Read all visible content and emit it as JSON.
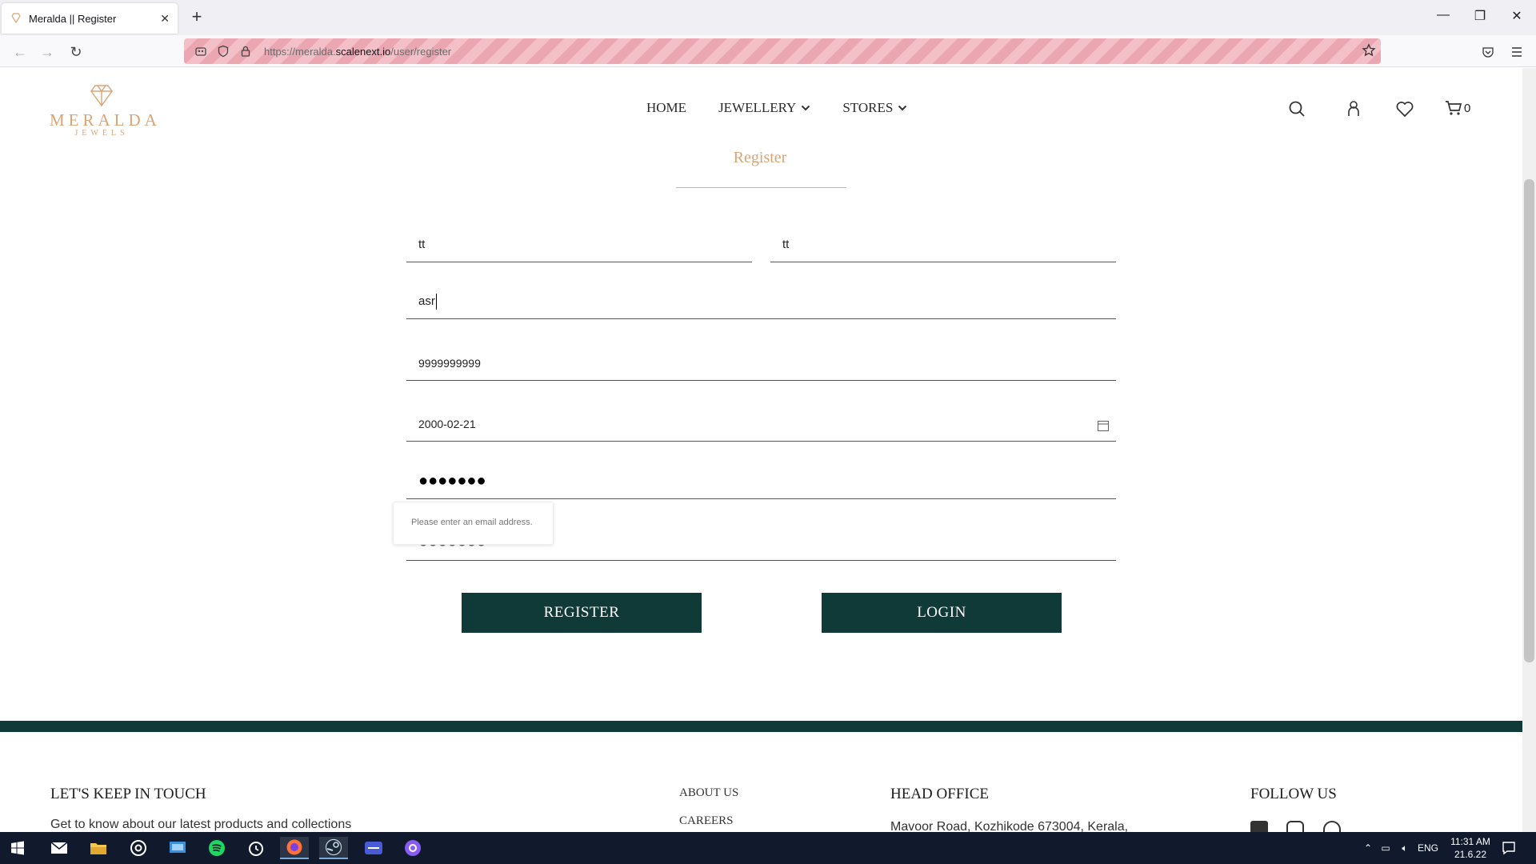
{
  "browser": {
    "tab_title": "Meralda || Register",
    "url_prefix": "https://meralda.",
    "url_domain": "scalenext.io",
    "url_path": "/user/register"
  },
  "site": {
    "logo_word": "MERALDA",
    "logo_sub": "JEWELS",
    "nav": {
      "home": "HOME",
      "jewellery": "JEWELLERY",
      "stores": "STORES"
    },
    "cart_count": "0"
  },
  "form": {
    "title": "Register",
    "first_name": "tt",
    "last_name": "tt",
    "email": "asr",
    "phone": "9999999999",
    "dob": "2000-02-21",
    "password_mask": "●●●●●●●",
    "confirm_mask": "●●●●●●●",
    "tooltip": "Please enter an email address.",
    "register_label": "REGISTER",
    "login_label": "LOGIN"
  },
  "footer": {
    "touch_heading": "LET'S KEEP IN TOUCH",
    "touch_text": "Get to know about our latest products and collections",
    "about": "ABOUT US",
    "careers": "CAREERS",
    "office_heading": "HEAD OFFICE",
    "office_address": "Mavoor Road, Kozhikode 673004, Kerala,",
    "follow_heading": "FOLLOW US"
  },
  "taskbar": {
    "lang": "ENG",
    "time": "11:31 AM",
    "date": "21.6.22"
  },
  "colors": {
    "brand_gold": "#d9a575",
    "brand_green": "#0f3a37",
    "taskbar": "#101a2c"
  }
}
